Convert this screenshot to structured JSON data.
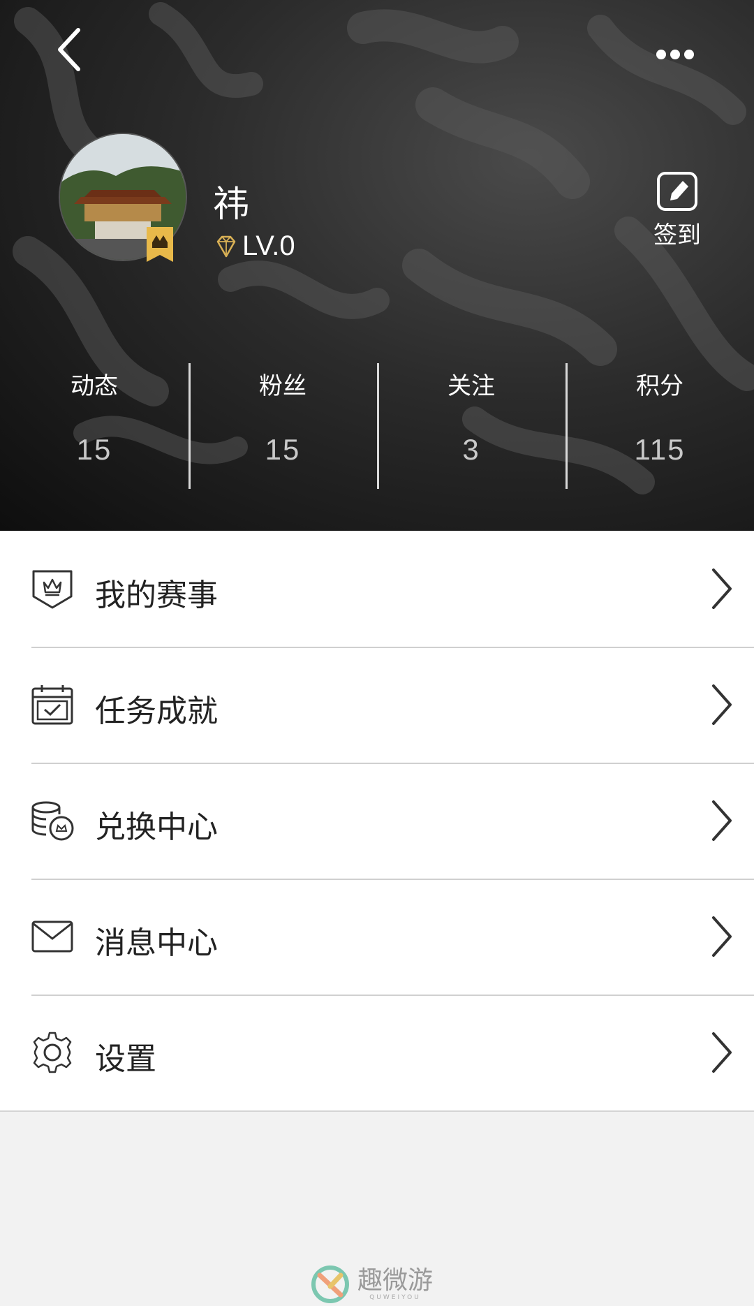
{
  "profile": {
    "username": "祎",
    "level": "LV.0",
    "checkin_label": "签到"
  },
  "stats": [
    {
      "label": "动态",
      "value": "15"
    },
    {
      "label": "粉丝",
      "value": "15"
    },
    {
      "label": "关注",
      "value": "3"
    },
    {
      "label": "积分",
      "value": "115"
    }
  ],
  "menu": [
    {
      "label": "我的赛事",
      "icon": "crown-shield-icon"
    },
    {
      "label": "任务成就",
      "icon": "calendar-check-icon"
    },
    {
      "label": "兑换中心",
      "icon": "coins-icon"
    },
    {
      "label": "消息中心",
      "icon": "mail-icon"
    },
    {
      "label": "设置",
      "icon": "gear-icon"
    }
  ],
  "footer": {
    "brand": "趣微游",
    "brand_sub": "QUWEIYOU"
  },
  "colors": {
    "header_dark": "#0e0e0e",
    "badge_gold": "#e8b94a",
    "page_bg": "#f2f2f2"
  }
}
